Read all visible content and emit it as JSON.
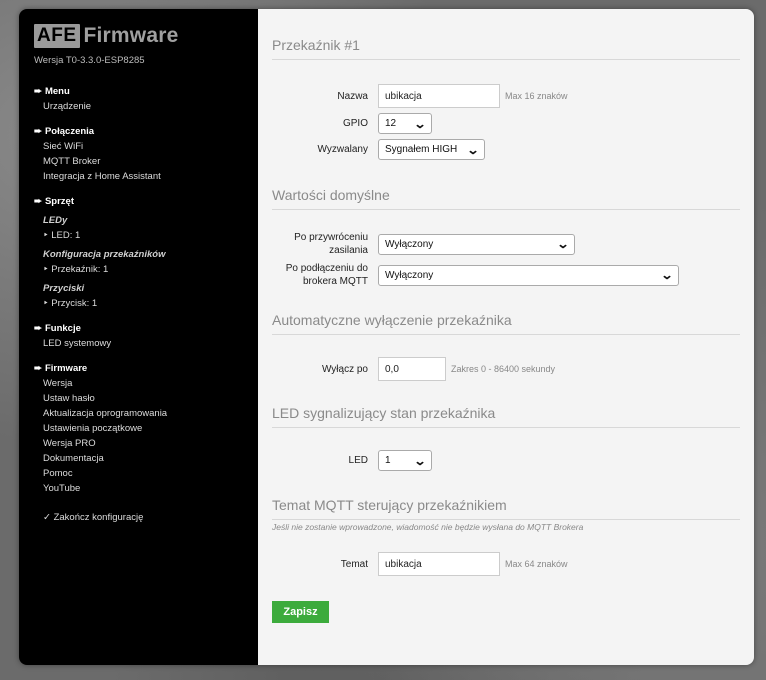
{
  "sidebar": {
    "logo_box": "AFE",
    "logo_text": "Firmware",
    "version": "Wersja T0-3.3.0-ESP8285",
    "sections": {
      "menu": {
        "title": "Menu",
        "items": [
          "Urządzenie"
        ]
      },
      "connections": {
        "title": "Połączenia",
        "items": [
          "Sieć WiFi",
          "MQTT Broker",
          "Integracja z Home Assistant"
        ]
      },
      "hardware": {
        "title": "Sprzęt",
        "leds_title": "LEDy",
        "leds_item": "‣ LED: 1",
        "relay_title": "Konfiguracja przekaźników",
        "relay_item": "‣ Przekaźnik: 1",
        "buttons_title": "Przyciski",
        "buttons_item": "‣ Przycisk: 1"
      },
      "functions": {
        "title": "Funkcje",
        "items": [
          "LED systemowy"
        ]
      },
      "firmware": {
        "title": "Firmware",
        "items": [
          "Wersja",
          "Ustaw hasło",
          "Aktualizacja oprogramowania",
          "Ustawienia początkowe",
          "Wersja PRO",
          "Dokumentacja",
          "Pomoc",
          "YouTube"
        ]
      }
    },
    "finish": "✓ Zakończ konfigurację"
  },
  "main": {
    "relay": {
      "header": "Przekaźnik #1",
      "name_label": "Nazwa",
      "name_value": "ubikacja",
      "name_hint": "Max 16 znaków",
      "gpio_label": "GPIO",
      "gpio_value": "12",
      "trigger_label": "Wyzwalany",
      "trigger_value": "Sygnałem HIGH"
    },
    "defaults": {
      "header": "Wartości domyślne",
      "restore_label_1": "Po przywróceniu",
      "restore_label_2": "zasilania",
      "restore_value": "Wyłączony",
      "mqtt_label_1": "Po podłączeniu do",
      "mqtt_label_2": "brokera MQTT",
      "mqtt_value": "Wyłączony"
    },
    "auto_off": {
      "header": "Automatyczne wyłączenie przekaźnika",
      "label": "Wyłącz po",
      "value": "0,0",
      "hint": "Zakres 0 - 86400 sekundy"
    },
    "led": {
      "header": "LED sygnalizujący stan przekaźnika",
      "label": "LED",
      "value": "1"
    },
    "mqtt_topic": {
      "header": "Temat MQTT sterujący przekaźnikiem",
      "note": "Jeśli nie zostanie wprowadzone, wiadomość nie będzie wysłana do MQTT Brokera",
      "label": "Temat",
      "value": "ubikacja",
      "hint": "Max 64 znaków"
    },
    "save_label": "Zapisz"
  },
  "colors": {
    "save_button": "#3cab3c",
    "sidebar_bg": "#000000",
    "panel_bg": "#f4f4f4"
  }
}
